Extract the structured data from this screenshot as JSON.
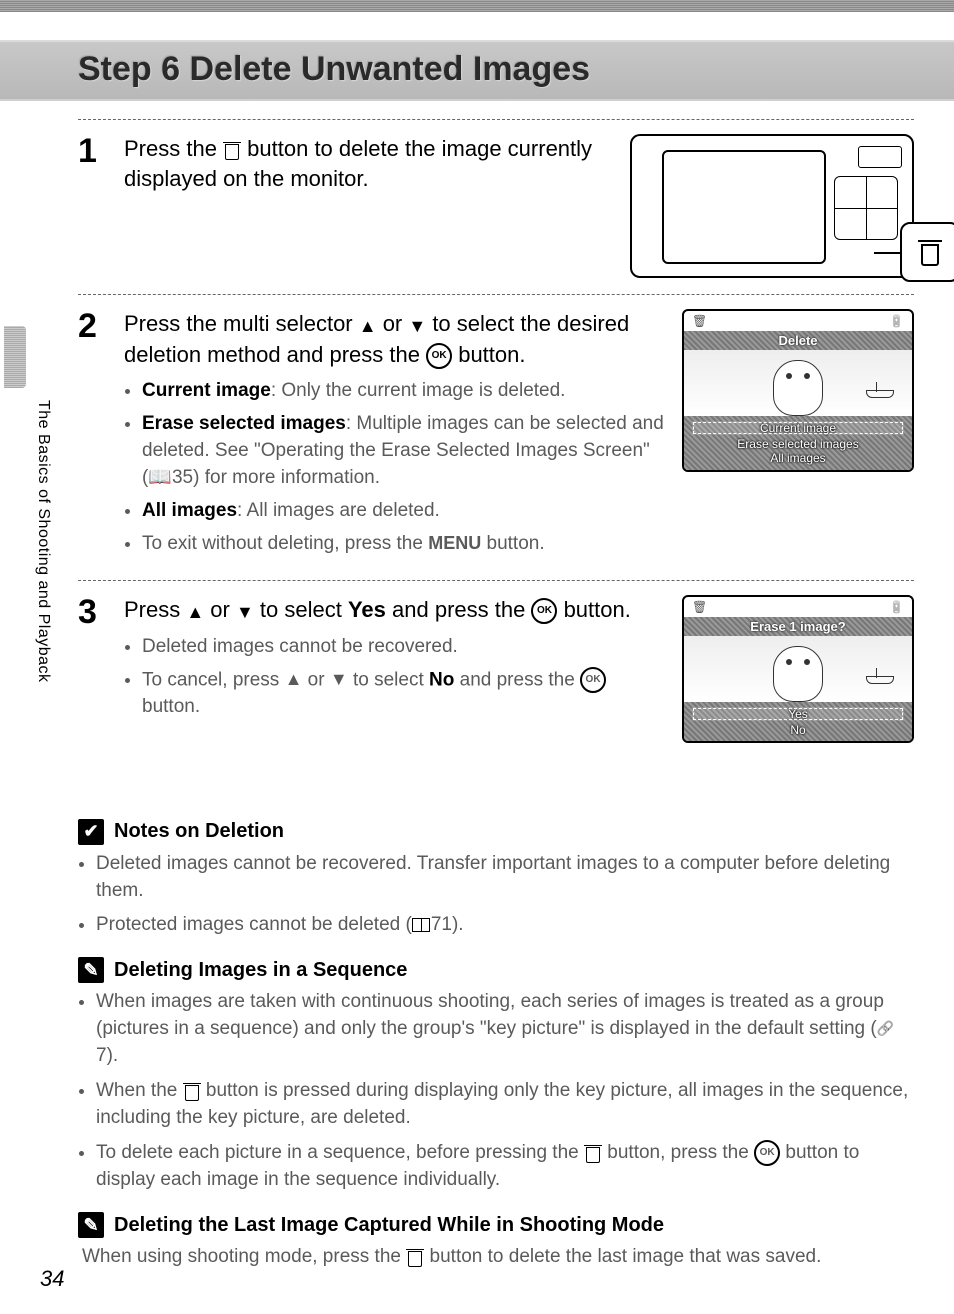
{
  "header": {
    "title": "Step 6 Delete Unwanted Images"
  },
  "side_tab": "The Basics of Shooting and Playback",
  "page_number": "34",
  "steps": [
    {
      "num": "1",
      "text_parts": [
        "Press the ",
        " button to delete the image currently displayed on the monitor."
      ]
    },
    {
      "num": "2",
      "text_parts": [
        "Press the multi selector ",
        " or ",
        " to select the desired deletion method and press the ",
        " button."
      ],
      "bullets": [
        {
          "bold": "Current image",
          "rest": ": Only the current image is deleted."
        },
        {
          "bold": "Erase selected images",
          "rest": ": Multiple images can be selected and deleted. See \"Operating the Erase Selected Images Screen\" (📖35) for more information."
        },
        {
          "bold": "All images",
          "rest": ": All images are deleted."
        },
        {
          "bold": "",
          "rest": "To exit without deleting, press the MENU button."
        }
      ]
    },
    {
      "num": "3",
      "text_parts": [
        "Press ",
        " or ",
        " to select ",
        "Yes",
        " and press the ",
        " button."
      ],
      "bullets": [
        {
          "bold": "",
          "rest": "Deleted images cannot be recovered."
        },
        {
          "bold": "",
          "rest": "To cancel, press ▲ or ▼ to select No and press the OK button."
        }
      ]
    }
  ],
  "screens": {
    "delete_menu": {
      "title": "Delete",
      "options": [
        "Current image",
        "Erase selected images",
        "All images"
      ]
    },
    "confirm": {
      "title": "Erase 1 image?",
      "options": [
        "Yes",
        "No"
      ]
    }
  },
  "notes": [
    {
      "icon": "check",
      "title": "Notes on Deletion",
      "bullets": [
        "Deleted images cannot be recovered. Transfer important images to a computer before deleting them.",
        "Protected images cannot be deleted (📖71)."
      ]
    },
    {
      "icon": "pencil",
      "title": "Deleting Images in a Sequence",
      "bullets": [
        "When images are taken with continuous shooting, each series of images is treated as a group (pictures in a sequence) and only the group's \"key picture\" is displayed in the default setting (🔗7).",
        "When the 🗑 button is pressed during displaying only the key picture, all images in the sequence, including the key picture, are deleted.",
        "To delete each picture in a sequence, before pressing the 🗑 button, press the OK button to display each image in the sequence individually."
      ]
    },
    {
      "icon": "pencil",
      "title": "Deleting the Last Image Captured While in Shooting Mode",
      "plain": "When using shooting mode, press the 🗑 button to delete the last image that was saved."
    }
  ]
}
